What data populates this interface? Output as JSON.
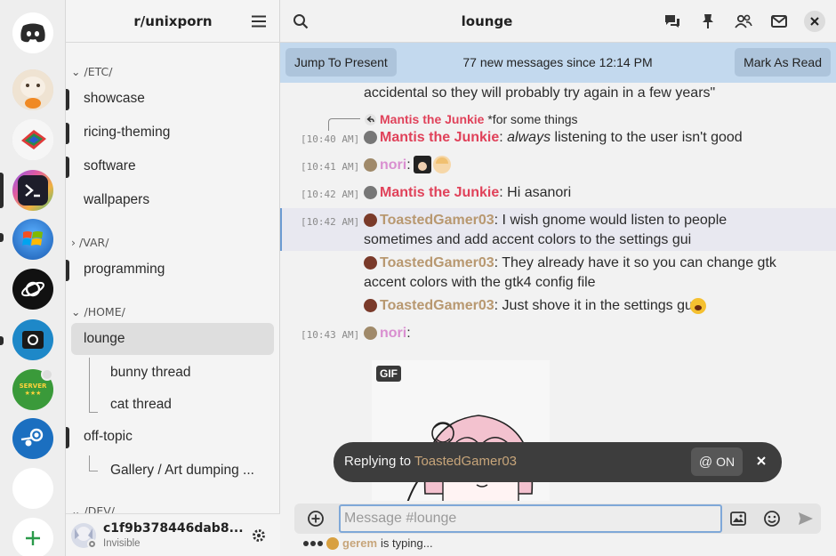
{
  "guild": {
    "name": "r/unixporn"
  },
  "categories": [
    {
      "label": "/ETC/",
      "expanded": true
    },
    {
      "label": "/VAR/",
      "expanded": false
    },
    {
      "label": "/HOME/",
      "expanded": true
    },
    {
      "label": "/DEV/",
      "expanded": true
    }
  ],
  "channels": {
    "showcase": "showcase",
    "ricing": "ricing-theming",
    "software": "software",
    "wallpapers": "wallpapers",
    "programming": "programming",
    "lounge": "lounge",
    "bunny": "bunny thread",
    "cat": "cat thread",
    "offtopic": "off-topic",
    "gallery": "Gallery / Art dumping ..."
  },
  "user": {
    "name": "c1f9b378446dab8...",
    "status": "Invisible"
  },
  "header": {
    "channel_title": "lounge"
  },
  "new_messages": {
    "jump_label": "Jump To Present",
    "text": "77 new messages since 12:14 PM",
    "mark_read_label": "Mark As Read"
  },
  "messages": {
    "m0_text": "accidental so they will probably try again in a few years\"",
    "reply_author": "Mantis the Junkie",
    "reply_text": "*for some things",
    "m1_ts": "[10:40 AM]",
    "m1_author": "Mantis the Junkie",
    "m1_em": "always",
    "m1_text": " listening to the user isn't good",
    "m2_ts": "[10:41 AM]",
    "m2_author": "nori",
    "m3_ts": "[10:42 AM]",
    "m3_author": "Mantis the Junkie",
    "m3_text": ": Hi asanori",
    "m4_ts": "[10:42 AM]",
    "m4_author": "ToastedGamer03",
    "m4_text1": ": I wish gnome would listen to people",
    "m4_text2": "sometimes and add accent colors to the settings gui",
    "m5_author": "ToastedGamer03",
    "m5_text1": ": They already have it so you can change gtk",
    "m5_text2": "accent colors with the gtk4 config file",
    "m6_author": "ToastedGamer03",
    "m6_text": ": Just shove it in the settings gui",
    "m7_ts": "[10:43 AM]",
    "m7_author": "nori",
    "gif_badge": "GIF",
    "colon": ":"
  },
  "reply_banner": {
    "prefix": "Replying to",
    "name": "ToastedGamer03",
    "mention_label": "ON",
    "mention_symbol": "@"
  },
  "composer": {
    "placeholder": "Message #lounge"
  },
  "typing": {
    "user": "gerem",
    "text": "is typing..."
  },
  "colors": {
    "accent": "#6c9bd2",
    "newbar": "#c3d9ee",
    "mantis": "#e0425a",
    "nori": "#d98fd0",
    "toasted": "#b89870"
  }
}
